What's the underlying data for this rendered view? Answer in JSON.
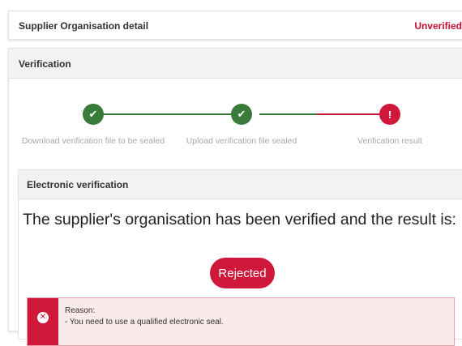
{
  "header": {
    "title": "Supplier Organisation detail",
    "status": "Unverified",
    "status_color": "#c8102e"
  },
  "verification": {
    "title": "Verification",
    "steps": [
      {
        "label": "Download verification file to be sealed",
        "state": "done",
        "icon": "check-icon"
      },
      {
        "label": "Upload verification file sealed",
        "state": "done",
        "icon": "check-icon"
      },
      {
        "label": "Verification result",
        "state": "error",
        "icon": "exclamation-icon"
      }
    ],
    "colors": {
      "done": "#3a7a3a",
      "error": "#d0193a"
    }
  },
  "electronic": {
    "title": "Electronic verification",
    "message": "The supplier's organisation has been verified and the result is:",
    "result": "Rejected",
    "reason_title": "Reason:",
    "reasons": [
      "-   You need to use a qualified electronic seal."
    ]
  }
}
